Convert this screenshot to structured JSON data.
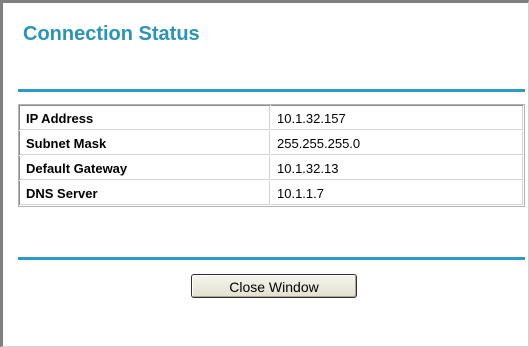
{
  "page": {
    "title": "Connection Status"
  },
  "status_table": {
    "rows": [
      {
        "label": "IP Address",
        "value": "10.1.32.157"
      },
      {
        "label": "Subnet Mask",
        "value": "255.255.255.0"
      },
      {
        "label": "Default Gateway",
        "value": "10.1.32.13"
      },
      {
        "label": "DNS Server",
        "value": "10.1.1.7"
      }
    ]
  },
  "actions": {
    "close_label": "Close Window"
  },
  "colors": {
    "accent": "#2a93ba",
    "rule": "#2a9cc4"
  }
}
